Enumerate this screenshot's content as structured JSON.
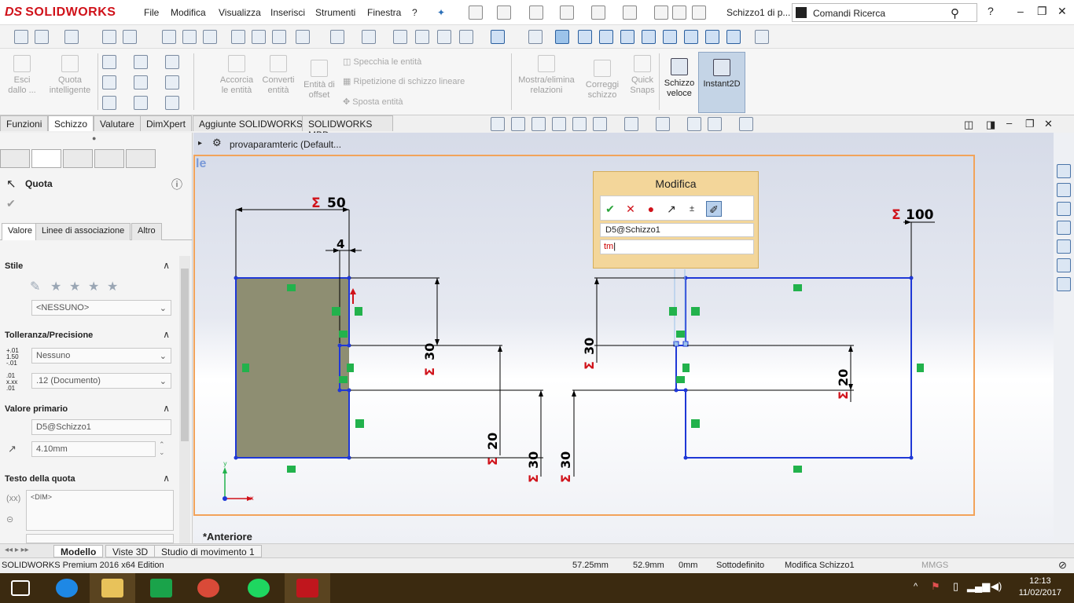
{
  "app": {
    "logo_ds": "DS",
    "logo_name": "SOLIDWORKS",
    "doc_title": "Schizzo1 di p...",
    "search_placeholder": "Comandi Ricerca"
  },
  "menu": [
    "File",
    "Modifica",
    "Visualizza",
    "Inserisci",
    "Strumenti",
    "Finestra",
    "?"
  ],
  "command_manager": {
    "items": [
      {
        "label_1": "Esci",
        "label_2": "dallo ..."
      },
      {
        "label_1": "Quota",
        "label_2": "intelligente"
      },
      {
        "label_1": "Accorcia",
        "label_2": "le entità"
      },
      {
        "label_1": "Converti",
        "label_2": "entità"
      },
      {
        "label_1": "Entità di",
        "label_2": "offset"
      },
      {
        "label_1": "Mostra/elimina",
        "label_2": "relazioni"
      },
      {
        "label_1": "Correggi",
        "label_2": "schizzo"
      },
      {
        "label_1": "Quick",
        "label_2": "Snaps"
      },
      {
        "label_1": "Schizzo",
        "label_2": "veloce"
      },
      {
        "label_1": "Instant2D",
        "label_2": ""
      }
    ],
    "row_items": [
      "Specchia le entità",
      "Ripetizione di schizzo lineare",
      "Sposta entità"
    ]
  },
  "tabs": [
    "Funzioni",
    "Schizzo",
    "Valutare",
    "DimXpert",
    "Aggiunte SOLIDWORKS",
    "SOLIDWORKS MBD"
  ],
  "active_tab": "Schizzo",
  "panel": {
    "title": "Quota",
    "subtabs": [
      "Valore",
      "Linee di associazione",
      "Altro"
    ],
    "stile_label": "Stile",
    "stile_value": "<NESSUNO>",
    "tolerance_label": "Tolleranza/Precisione",
    "tolerance_type": "Nessuno",
    "precision": ".12 (Documento)",
    "primary_label": "Valore primario",
    "primary_name": "D5@Schizzo1",
    "primary_value": "4.10mm",
    "dimtext_label": "Testo della quota",
    "dimtext_value": "<DIM>"
  },
  "breadcrumb": "provaparamteric  (Default...",
  "view_label": "*Anteriore",
  "dialog": {
    "title": "Modifica",
    "name": "D5@Schizzo1",
    "input": "tm"
  },
  "sketch": {
    "dims": {
      "d50": "50",
      "d4": "4",
      "d100": "100",
      "d30a": "30",
      "d30b": "30",
      "d20a": "20",
      "d20b": "20",
      "d30c": "30",
      "d30d": "30"
    },
    "corner_label": "le"
  },
  "bottom_tabs": [
    "Modello",
    "Viste 3D",
    "Studio di movimento 1"
  ],
  "status": {
    "product": "SOLIDWORKS Premium 2016 x64 Edition",
    "x": "57.25mm",
    "y": "52.9mm",
    "z": "0mm",
    "state": "Sottodefinito",
    "mode": "Modifica Schizzo1",
    "units": "MMGS"
  },
  "clock": {
    "time": "12:13",
    "date": "11/02/2017"
  },
  "colors": {
    "accent": "#d0121a",
    "sketch_blue": "#1f38d6",
    "highlight_frame": "#f2a35a",
    "dialog_bg": "#f3d69a"
  }
}
